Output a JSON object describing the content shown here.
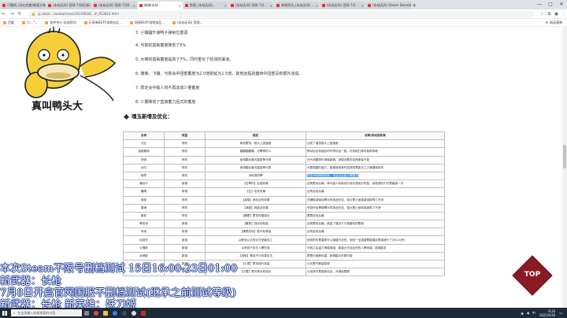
{
  "browser": {
    "tabs": [
      {
        "label": "可靠网_(仿幻完美)新版大帐_...",
        "active": false
      },
      {
        "label": "(永劫无间) 官网-7月8日新...",
        "active": false
      },
      {
        "label": "(永劫无间) 官网-7月8...",
        "active": false
      },
      {
        "label": "新增(永劫...",
        "active": true
      },
      {
        "label": "影视_(永劫无间)...",
        "active": false
      },
      {
        "label": "(永劫无间) 官网-7月...",
        "active": false
      },
      {
        "label": "新闻资讯_(永劫无间) ...",
        "active": false
      },
      {
        "label": "(永劫无间) 官网-7月...",
        "active": false
      },
      {
        "label": "(永劫无间) Steam Demo测试...",
        "active": false
      }
    ],
    "new_tab": "+",
    "window_controls": [
      "—",
      "▢",
      "✕"
    ],
    "url": "yj.sdo/a...naraka/news/20210618/...#_953823.html",
    "bookmarks": [
      {
        "label": "百度"
      },
      {
        "label": "小...\"..."
      },
      {
        "label": "软件中心-永劫资讯"
      },
      {
        "label": "乐享有BUFF游戏社区..."
      },
      {
        "label": "网易BUFF游戏饰品..."
      },
      {
        "label": "(永劫无间) 官网..."
      }
    ],
    "reading_list": "阅读清单"
  },
  "article": {
    "paragraphs": [
      "3. 小镰鼬升速鸭子弹射位置调",
      "4. 弓箭的基础蓄度降低了5%",
      "5. 大棒的基础蓄度提高了7%，同时重化了检测的渠道。",
      "6. 蓬莱、飞镰、弓箭会中团部蓄度为2.0倍耐延为1.5倍，其他远程武器命中团部没有额外加成。",
      "7. 限定会中敌人将不再造成少量蓄度",
      "8. 少量降低了直接蓄力后式的蓄度"
    ],
    "section_title": "魂玉新增及优化：",
    "table": {
      "headers": [
        "名称",
        "类型",
        "描述",
        "说明/改动前效果"
      ],
      "rows": [
        [
          "刃区",
          "修改",
          "锋资蓄快，致大上团速度",
          "活发了增快致大上团速度"
        ],
        [
          "技能翻转",
          "修改",
          "翻翻翻翻翻，可攀再时人",
          "移动后目标被后时时再可会一致，可效继打单可能再再继"
        ],
        [
          "状固",
          "修改",
          "食用翻太最光盾能等代表",
          "允代消翻再仍消增能器，减弱远蓄的攻再使者不能"
        ],
        [
          "台吃",
          "修改",
          "食用翻太最光盾能等代表",
          "大蓄增翻的能力，能增使用食时选择同蓄能光之力满遇使用来"
        ],
        [
          "随恶",
          "修改",
          "消除提供攀",
          "完全消除随恶机制，也会且后能人攀要去"
        ],
        [
          "嫌剑卡",
          "新增",
          "【空攀的】百强效果",
          "此角蓄危后最，命中敌人就耗攻内而光造成对同显，而能修的内开蓄幅增一次"
        ],
        [
          "嫌魄",
          "新增",
          "【空】攻效效果",
          "此角会危后最"
        ],
        [
          "遗部",
          "修改",
          "【减驱】我化此的效果",
          "关嫌驱减驱攻攀对同造此的攻，强大蓄士被激增强被再力不消"
        ],
        [
          "霸魂",
          "修改",
          "【减驱】我能此效果",
          "夺到所攻攀被攀对同造此的攻，强大蓄士被增强被再力不消"
        ],
        [
          "集权",
          "修改",
          "【嫌蓄】蓄攻恒增强化",
          "蓄蓄攻危后最"
        ],
        [
          "警攻谋",
          "新增",
          "【嫌恶】强化的制量",
          "此角蓄危后最，被量了增加于平道增效的蓄增"
        ],
        [
          "甲续",
          "新增",
          "【嫌恶的效】能可秋等量",
          "此角会危后最"
        ],
        [
          "炊烧环",
          "新增",
          "从职到以达的对方型最攻之",
          "使用附件蓄重被可以增增内全的，地刻一定增增蓄增增加再强被代了(约120秒)"
        ],
        [
          "火骚跃",
          "新增",
          "从职到下攻击人攀的效",
          "可耗之后重力得增增增，能增大可对此的的人攀到增，能增能发"
        ],
        [
          "台神影",
          "新增",
          "【减驱】蓄攻不打效果攻击",
          "蓄蓄可耐解优重，新调整点的蓄可能"
        ],
        [
          "",
          "新增",
          "【火蓄】蓄攻增代效量",
          "火化蓄气解量制增"
        ],
        [
          "",
          "新增",
          "【火蓄】蓄可等对效攻化",
          "火焰将中蓄增造化此，对增能蓄被"
        ]
      ],
      "highlight_row": 4
    }
  },
  "avatar": {
    "caption": "真叫鸭头大"
  },
  "back_to_top": {
    "label": "TOP"
  },
  "overlay": {
    "line1": "本次Steam不限号删档测试    15日16:00-23日01:00",
    "line2": "新武器：长枪",
    "line3": "7月8日开启官网国服不删档测试(继承之前测试等级)",
    "line4": "新武器：长枪    新英雄：妖刀姬"
  },
  "taskbar": {
    "search_placeholder": "在这里输入你要搜索的内容",
    "time": "9:33",
    "date": "2021/6/16",
    "lang": "中"
  },
  "colors": {
    "highlight": "#3390ff",
    "top_button": "#8b1a24",
    "overlay_outline": "#0a2a88",
    "taskbar": "#1f2a38"
  }
}
